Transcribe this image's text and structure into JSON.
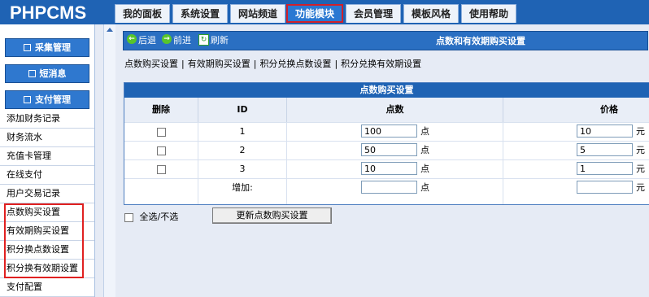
{
  "app": {
    "logo": "PHPCMS"
  },
  "tabs": [
    {
      "label": "我的面板"
    },
    {
      "label": "系统设置"
    },
    {
      "label": "网站频道"
    },
    {
      "label": "功能模块"
    },
    {
      "label": "会员管理"
    },
    {
      "label": "模板风格"
    },
    {
      "label": "使用帮助"
    }
  ],
  "sidebar": {
    "categories": [
      {
        "label": "采集管理"
      },
      {
        "label": "短消息"
      },
      {
        "label": "支付管理"
      }
    ],
    "items": [
      {
        "label": "添加财务记录"
      },
      {
        "label": "财务流水"
      },
      {
        "label": "充值卡管理"
      },
      {
        "label": "在线支付"
      },
      {
        "label": "用户交易记录"
      },
      {
        "label": "点数购买设置"
      },
      {
        "label": "有效期购买设置"
      },
      {
        "label": "积分换点数设置"
      },
      {
        "label": "积分换有效期设置"
      },
      {
        "label": "支付配置"
      }
    ]
  },
  "navbar": {
    "back": "后退",
    "forward": "前进",
    "refresh": "刷新",
    "title": "点数和有效期购买设置"
  },
  "sublinks": [
    "点数购买设置",
    "有效期购买设置",
    "积分兑换点数设置",
    "积分兑换有效期设置"
  ],
  "panel": {
    "title": "点数购买设置",
    "headers": {
      "delete": "删除",
      "id": "ID",
      "points": "点数",
      "price": "价格"
    },
    "rows": [
      {
        "id": "1",
        "points": "100",
        "price": "10"
      },
      {
        "id": "2",
        "points": "50",
        "price": "5"
      },
      {
        "id": "3",
        "points": "10",
        "price": "1"
      }
    ],
    "add_label": "增加:",
    "unit_points": "点",
    "unit_price": "元"
  },
  "footer": {
    "select_all": "全选/不选",
    "update_button": "更新点数购买设置"
  }
}
